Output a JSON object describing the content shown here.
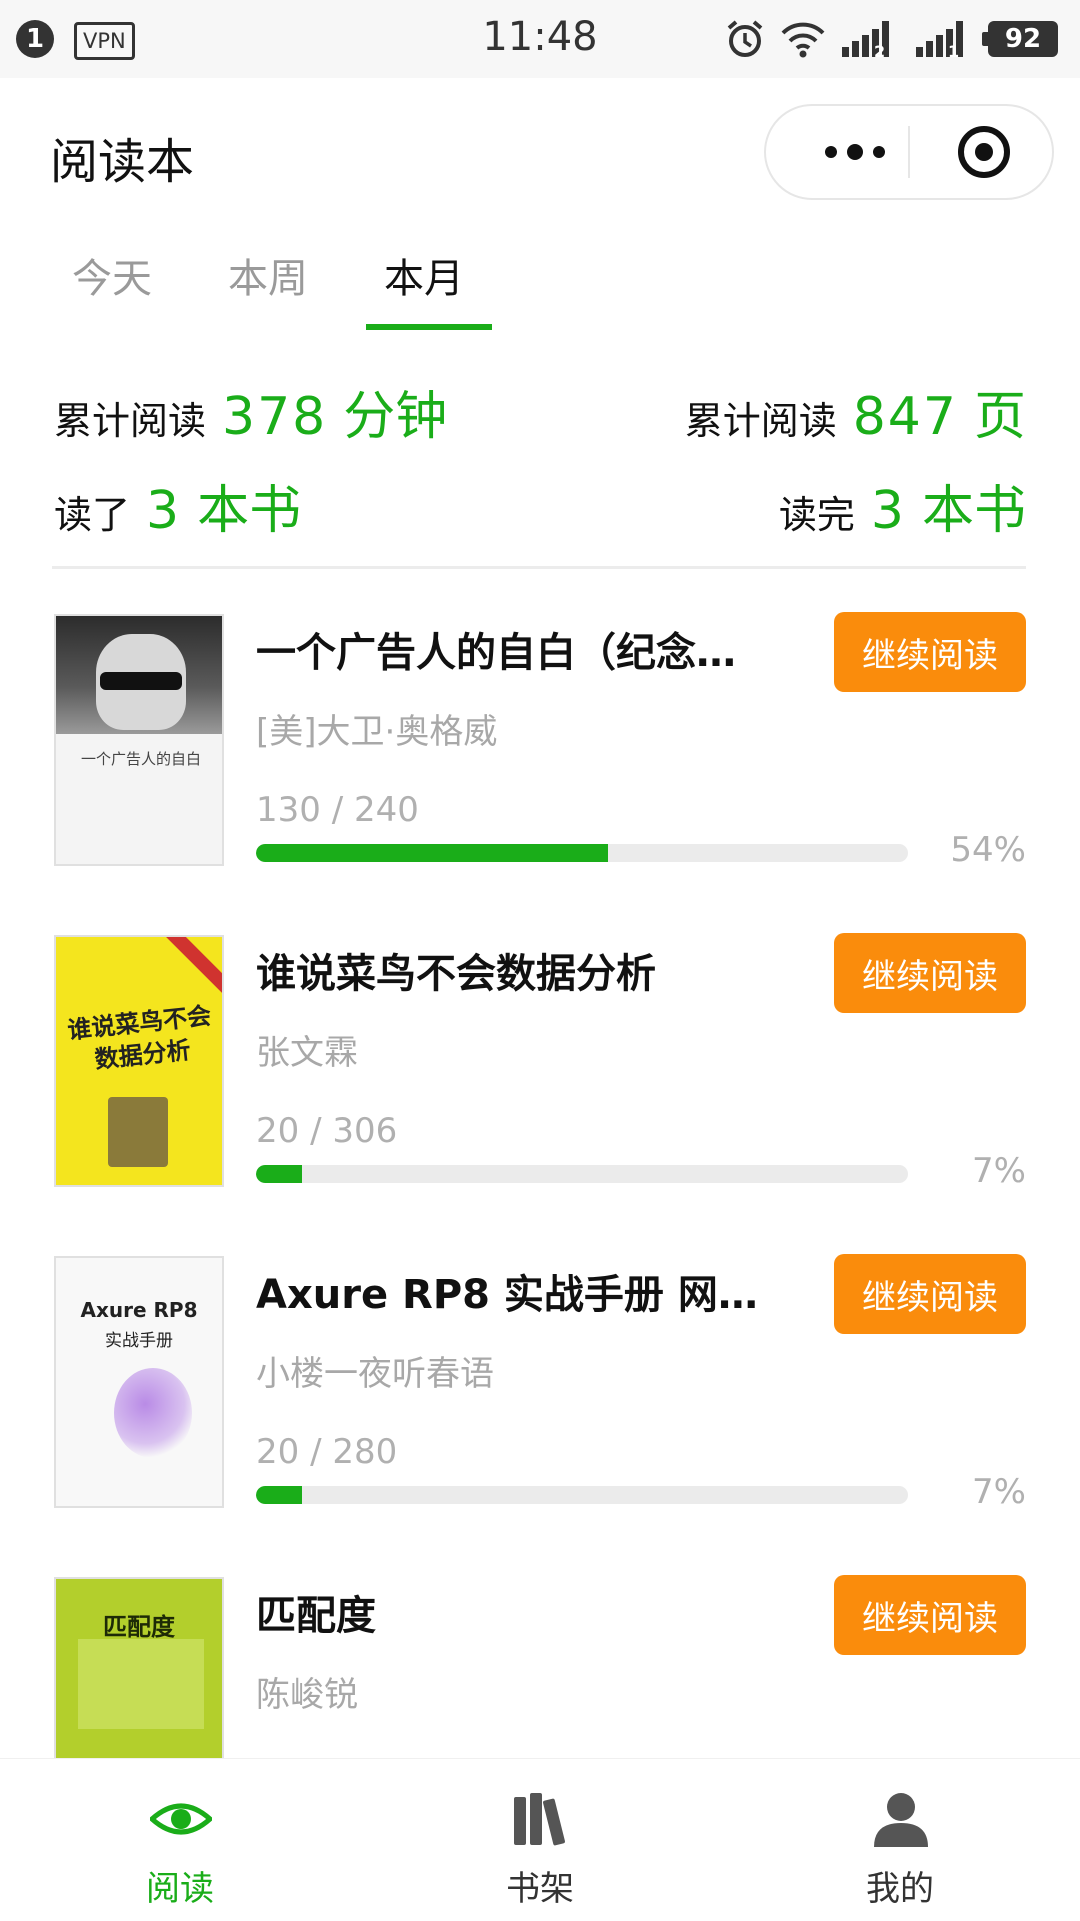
{
  "status_bar": {
    "notification_count": "1",
    "vpn_label": "VPN",
    "time": "11:48",
    "sim1": "2",
    "sim2": "1",
    "battery": "92"
  },
  "header": {
    "title": "阅读本"
  },
  "tabs": [
    {
      "label": "今天"
    },
    {
      "label": "本周"
    },
    {
      "label": "本月"
    }
  ],
  "active_tab_index": 2,
  "stats": {
    "read_time_label": "累计阅读",
    "read_time_value": "378",
    "read_time_unit": "分钟",
    "pages_label": "累计阅读",
    "pages_value": "847",
    "pages_unit": "页",
    "books_read_label": "读了",
    "books_read_value": "3",
    "books_read_unit": "本书",
    "books_finished_label": "读完",
    "books_finished_value": "3",
    "books_finished_unit": "本书"
  },
  "books": [
    {
      "title": "一个广告人的自白（纪念…",
      "author": "[美]大卫·奥格威",
      "pages": "130 / 240",
      "percent": "54%",
      "progress": 0.54,
      "button": "继续阅读",
      "cover_text": "一个广告人的自白"
    },
    {
      "title": "谁说菜鸟不会数据分析",
      "author": "张文霖",
      "pages": "20 / 306",
      "percent": "7%",
      "progress": 0.07,
      "button": "继续阅读",
      "cover_text": "谁说菜鸟不会数据分析"
    },
    {
      "title": "Axure RP8 实战手册 网…",
      "author": "小楼一夜听春语",
      "pages": "20 / 280",
      "percent": "7%",
      "progress": 0.07,
      "button": "继续阅读",
      "cover_title": "Axure RP8",
      "cover_subtitle": "实战手册"
    },
    {
      "title": "匹配度",
      "author": "陈峻锐",
      "button": "继续阅读",
      "cover_text": "匹配度"
    }
  ],
  "tab_bar": [
    {
      "label": "阅读",
      "icon": "eye-icon"
    },
    {
      "label": "书架",
      "icon": "bookshelf-icon"
    },
    {
      "label": "我的",
      "icon": "user-icon"
    }
  ],
  "colors": {
    "accent_green": "#1aad19",
    "button_orange": "#fa8c0c"
  }
}
